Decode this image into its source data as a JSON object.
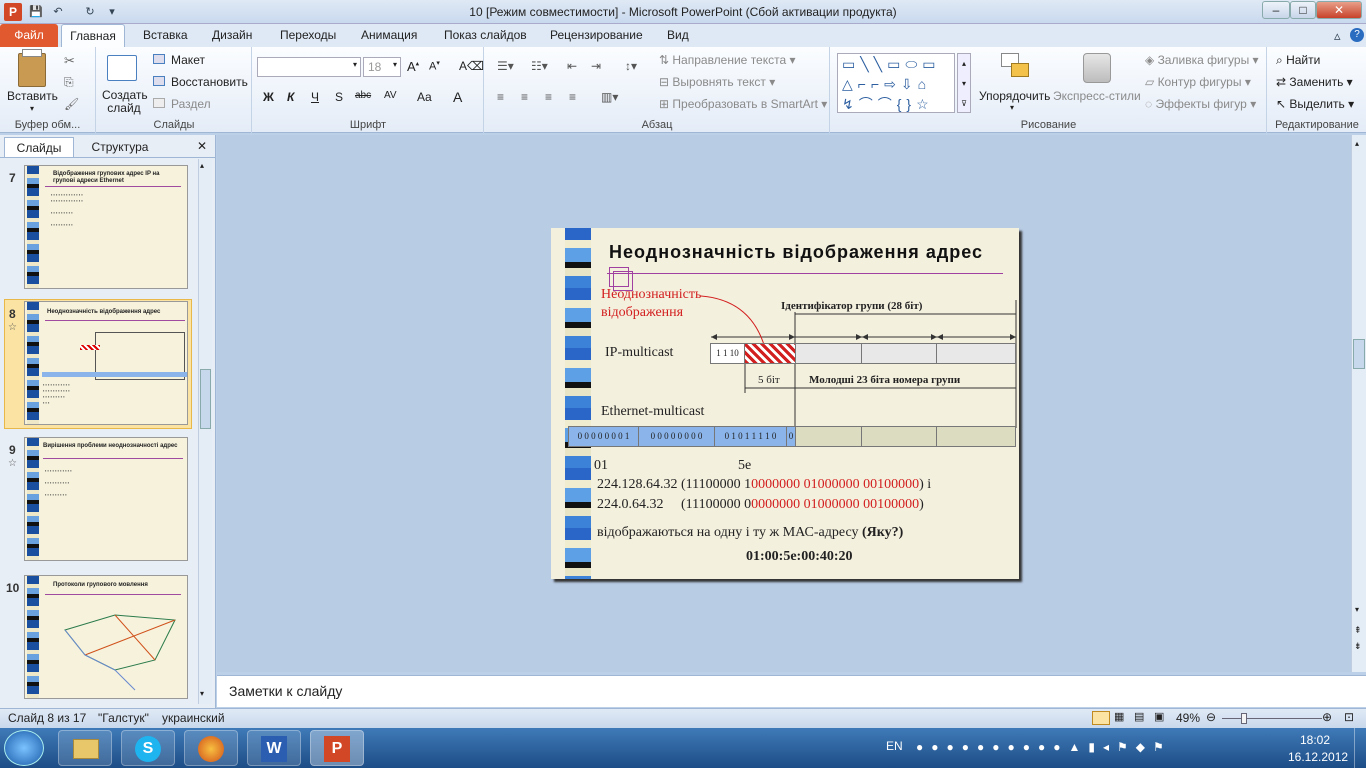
{
  "window": {
    "title": "10 [Режим совместимости]  -  Microsoft PowerPoint (Сбой активации продукта)",
    "min": "–",
    "max": "□",
    "close": "✕"
  },
  "tabs": {
    "file": "Файл",
    "items": [
      "Главная",
      "Вставка",
      "Дизайн",
      "Переходы",
      "Анимация",
      "Показ слайдов",
      "Рецензирование",
      "Вид"
    ]
  },
  "ribbon": {
    "clipboard": {
      "paste": "Вставить",
      "label": "Буфер обм..."
    },
    "slides": {
      "new_slide": "Создать слайд",
      "layout": "Макет",
      "reset": "Восстановить",
      "section": "Раздел",
      "label": "Слайды"
    },
    "font": {
      "size": "18",
      "label": "Шрифт",
      "b": "Ж",
      "i": "К",
      "u": "Ч",
      "s": "S",
      "abc": "abc",
      "av": "AV",
      "aa": "Aa",
      "a": "A"
    },
    "paragraph": {
      "text_dir": "Направление текста",
      "align_text": "Выровнять текст",
      "smartart": "Преобразовать в SmartArt",
      "label": "Абзац"
    },
    "drawing": {
      "arrange": "Упорядочить",
      "styles": "Экспресс-стили",
      "fill": "Заливка фигуры",
      "outline": "Контур фигуры",
      "effects": "Эффекты фигур",
      "label": "Рисование"
    },
    "editing": {
      "find": "Найти",
      "replace": "Заменить",
      "select": "Выделить",
      "label": "Редактирование"
    }
  },
  "pane": {
    "tab_slides": "Слайды",
    "tab_outline": "Структура",
    "close": "✕",
    "thumbs": [
      {
        "num": "7",
        "title": "Відображення групових адрес IP на групові адреси Ethernet"
      },
      {
        "num": "8",
        "title": "Неоднозначність  відображення  адрес"
      },
      {
        "num": "9",
        "title": "Вирішення  проблеми  неоднозначності адрес"
      },
      {
        "num": "10",
        "title": "Протоколи групового мовлення"
      }
    ]
  },
  "slide": {
    "title": "Неоднозначність  відображення  адрес",
    "red_label": "Неоднозначність відображення",
    "group_id": "Ідентифікатор групи (28 біт)",
    "ip_multicast": "IP-multicast",
    "ip_bits": "1 1 10",
    "five_bit": "5 біт",
    "lower23": "Молодші 23 біта номера групи",
    "eth_multicast": "Ethernet-multicast",
    "eth_bits": [
      "0 0 0 0 0 0 0 1",
      "0 0 0 0 0 0 0 0",
      "0 1 0 1 1 1 1 0",
      "0"
    ],
    "hex01": "01",
    "hex5e": "5e",
    "addr1_ip": "224.128.64.32",
    "addr1_bin_a": "(11100000 1",
    "addr1_bin_red": "0000000 01000000 00100000",
    "addr1_bin_b": ") і",
    "addr2_ip": "224.0.64.32",
    "addr2_bin_a": "(11100000 0",
    "addr2_bin_red": "0000000 01000000 00100000",
    "addr2_bin_b": ")",
    "maps_text": "відображаються на одну і  ту ж МАС-адресу ",
    "maps_bold": "(Яку?)",
    "mac": "01:00:5e:00:40:20"
  },
  "notes": {
    "placeholder": "Заметки к слайду"
  },
  "status": {
    "slide": "Слайд 8 из 17",
    "theme": "\"Галстук\"",
    "lang": "украинский",
    "zoom": "49%"
  },
  "taskbar": {
    "lang": "EN",
    "time": "18:02",
    "date": "16.12.2012"
  }
}
